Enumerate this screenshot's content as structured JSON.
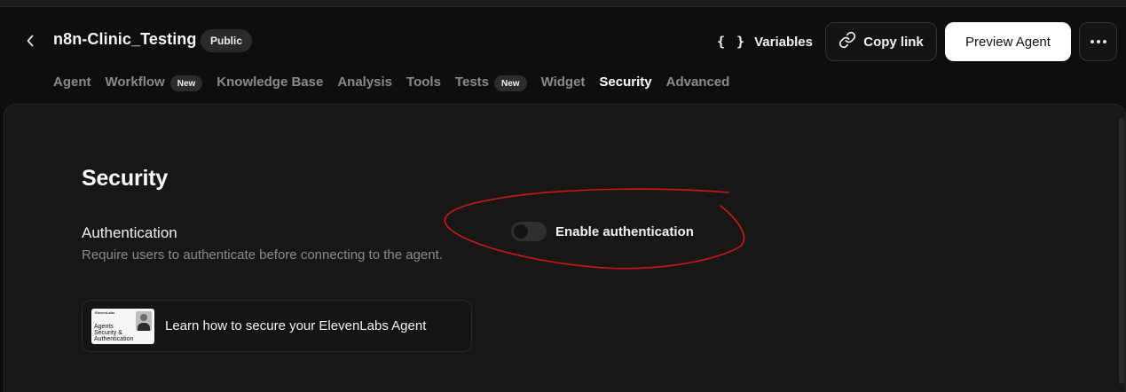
{
  "header": {
    "title": "n8n-Clinic_Testing",
    "visibility_badge": "Public",
    "variables_label": "Variables",
    "variables_icon": "braces",
    "copy_link_label": "Copy link",
    "preview_label": "Preview Agent"
  },
  "tabs": [
    {
      "label": "Agent",
      "badge": ""
    },
    {
      "label": "Workflow",
      "badge": "New"
    },
    {
      "label": "Knowledge Base",
      "badge": ""
    },
    {
      "label": "Analysis",
      "badge": ""
    },
    {
      "label": "Tools",
      "badge": ""
    },
    {
      "label": "Tests",
      "badge": "New"
    },
    {
      "label": "Widget",
      "badge": ""
    },
    {
      "label": "Security",
      "badge": "",
      "active": true
    },
    {
      "label": "Advanced",
      "badge": ""
    }
  ],
  "security": {
    "title": "Security",
    "authentication": {
      "label": "Authentication",
      "description": "Require users to authenticate before connecting to the agent.",
      "toggle_label": "Enable authentication",
      "enabled": false
    },
    "learn_card": {
      "text": "Learn how to secure your ElevenLabs Agent",
      "thumbnail": {
        "brand": "ElevenLabs",
        "lines": [
          "Agents",
          "Security &",
          "Authentication"
        ]
      }
    }
  },
  "colors": {
    "background": "#0e0e0e",
    "panel": "#171717",
    "annotation": "#d01616",
    "preview_button_bg": "#ffffff"
  }
}
